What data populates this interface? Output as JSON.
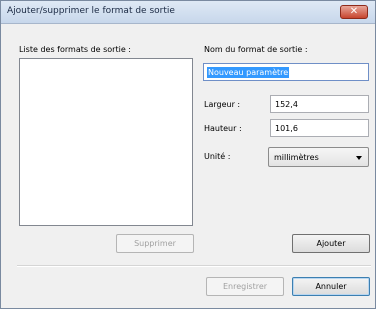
{
  "dialog": {
    "title": "Ajouter/supprimer le format de sortie",
    "close_symbol": "✕"
  },
  "left_panel": {
    "list_label": "Liste des formats de sortie :",
    "items": [],
    "delete_button": "Supprimer"
  },
  "right_panel": {
    "name_label": "Nom du format de sortie :",
    "name_value": "Nouveau paramètre",
    "width_label": "Largeur :",
    "width_value": "152,4",
    "height_label": "Hauteur :",
    "height_value": "101,6",
    "unit_label": "Unité :",
    "unit_value": "millimètres",
    "add_button": "Ajouter"
  },
  "footer": {
    "save_button": "Enregistrer",
    "cancel_button": "Annuler"
  },
  "icons": {
    "close": "close-icon",
    "dropdown": "chevron-down-icon"
  }
}
